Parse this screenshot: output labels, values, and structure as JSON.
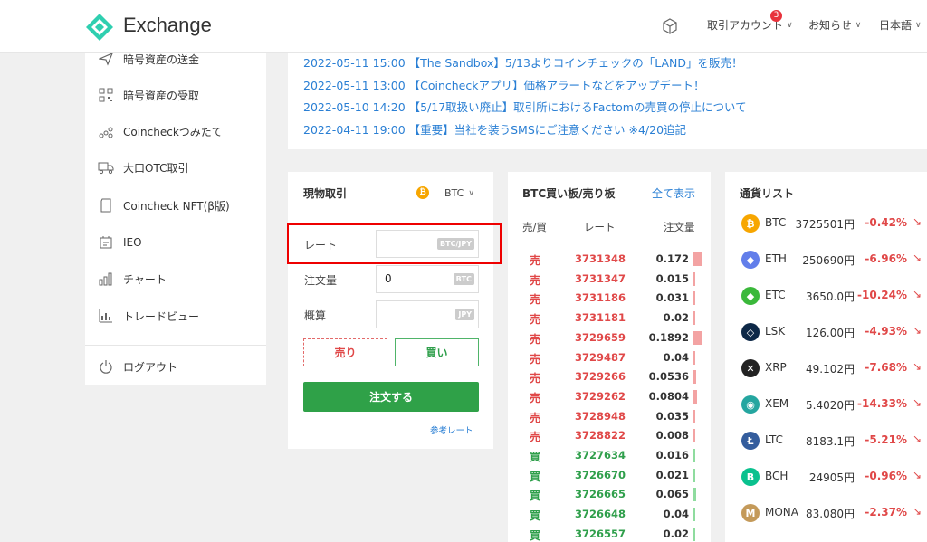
{
  "header": {
    "app_name": "Exchange",
    "account_label": "取引アカウント",
    "account_badge": "3",
    "notice_label": "お知らせ",
    "language_label": "日本語"
  },
  "sidebar": {
    "items": [
      {
        "label": "暗号資産の送金",
        "icon": "send-icon"
      },
      {
        "label": "暗号資産の受取",
        "icon": "qr-code-icon"
      },
      {
        "label": "Coincheckつみたて",
        "icon": "coins-icon"
      },
      {
        "label": "大口OTC取引",
        "icon": "truck-icon"
      },
      {
        "label": "Coincheck NFT(β版)",
        "icon": "card-icon"
      },
      {
        "label": "IEO",
        "icon": "ieo-icon"
      },
      {
        "label": "チャート",
        "icon": "bar-chart-icon"
      },
      {
        "label": "トレードビュー",
        "icon": "trade-chart-icon"
      }
    ],
    "logout_label": "ログアウト"
  },
  "news": [
    "2022-05-11 15:00 【The Sandbox】5/13よりコインチェックの「LAND」を販売！",
    "2022-05-11 13:00 【Coincheckアプリ】価格アラートなどをアップデート！",
    "2022-05-10 14:20 【5/17取扱い廃止】取引所におけるFactomの売買の停止について",
    "2022-04-11 19:00 【重要】当社を装うSMSにご注意ください ※4/20追記"
  ],
  "trade": {
    "title": "現物取引",
    "coin_glyph": "₿",
    "pair": "BTC",
    "rate_label": "レート",
    "rate_value": "",
    "rate_unit": "BTC/JPY",
    "amount_label": "注文量",
    "amount_value": "0",
    "amount_unit": "BTC",
    "estimate_label": "概算",
    "estimate_value": "",
    "estimate_unit": "JPY",
    "sell_label": "売り",
    "buy_label": "買い",
    "order_label": "注文する",
    "reference_rate_label": "参考レート"
  },
  "orderbook": {
    "title": "BTC買い板/売り板",
    "show_all": "全て表示",
    "col_side": "売/買",
    "col_rate": "レート",
    "col_qty": "注文量",
    "rows": [
      {
        "side": "売",
        "type": "sell",
        "price": "3731348",
        "qty": "0.172",
        "depth": 0.5
      },
      {
        "side": "売",
        "type": "sell",
        "price": "3731347",
        "qty": "0.015",
        "depth": 0.05
      },
      {
        "side": "売",
        "type": "sell",
        "price": "3731186",
        "qty": "0.031",
        "depth": 0.1
      },
      {
        "side": "売",
        "type": "sell",
        "price": "3731181",
        "qty": "0.02",
        "depth": 0.06
      },
      {
        "side": "売",
        "type": "sell",
        "price": "3729659",
        "qty": "0.1892",
        "depth": 0.55
      },
      {
        "side": "売",
        "type": "sell",
        "price": "3729487",
        "qty": "0.04",
        "depth": 0.12
      },
      {
        "side": "売",
        "type": "sell",
        "price": "3729266",
        "qty": "0.0536",
        "depth": 0.16
      },
      {
        "side": "売",
        "type": "sell",
        "price": "3729262",
        "qty": "0.0804",
        "depth": 0.24
      },
      {
        "side": "売",
        "type": "sell",
        "price": "3728948",
        "qty": "0.035",
        "depth": 0.1
      },
      {
        "side": "売",
        "type": "sell",
        "price": "3728822",
        "qty": "0.008",
        "depth": 0.03
      },
      {
        "side": "買",
        "type": "buy",
        "price": "3727634",
        "qty": "0.016",
        "depth": 0.05
      },
      {
        "side": "買",
        "type": "buy",
        "price": "3726670",
        "qty": "0.021",
        "depth": 0.06
      },
      {
        "side": "買",
        "type": "buy",
        "price": "3726665",
        "qty": "0.065",
        "depth": 0.19
      },
      {
        "side": "買",
        "type": "buy",
        "price": "3726648",
        "qty": "0.04",
        "depth": 0.12
      },
      {
        "side": "買",
        "type": "buy",
        "price": "3726557",
        "qty": "0.02",
        "depth": 0.06
      }
    ]
  },
  "currencies": {
    "title": "通貨リスト",
    "items": [
      {
        "symbol": "BTC",
        "price": "3725501円",
        "change": "-0.42%",
        "color": "#f7a600",
        "glyph": "₿"
      },
      {
        "symbol": "ETH",
        "price": "250690円",
        "change": "-6.96%",
        "color": "#627eea",
        "glyph": "◆"
      },
      {
        "symbol": "ETC",
        "price": "3650.0円",
        "change": "-10.24%",
        "color": "#3ab83a",
        "glyph": "◆"
      },
      {
        "symbol": "LSK",
        "price": "126.00円",
        "change": "-4.93%",
        "color": "#0d2847",
        "glyph": "◇"
      },
      {
        "symbol": "XRP",
        "price": "49.102円",
        "change": "-7.68%",
        "color": "#222222",
        "glyph": "✕"
      },
      {
        "symbol": "XEM",
        "price": "5.4020円",
        "change": "-14.33%",
        "color": "#25a6a0",
        "glyph": "◉"
      },
      {
        "symbol": "LTC",
        "price": "8183.1円",
        "change": "-5.21%",
        "color": "#345d9d",
        "glyph": "Ł"
      },
      {
        "symbol": "BCH",
        "price": "24905円",
        "change": "-0.96%",
        "color": "#0ac18e",
        "glyph": "B"
      },
      {
        "symbol": "MONA",
        "price": "83.080円",
        "change": "-2.37%",
        "color": "#c49a5a",
        "glyph": "M"
      }
    ],
    "down_arrow": "↘"
  }
}
